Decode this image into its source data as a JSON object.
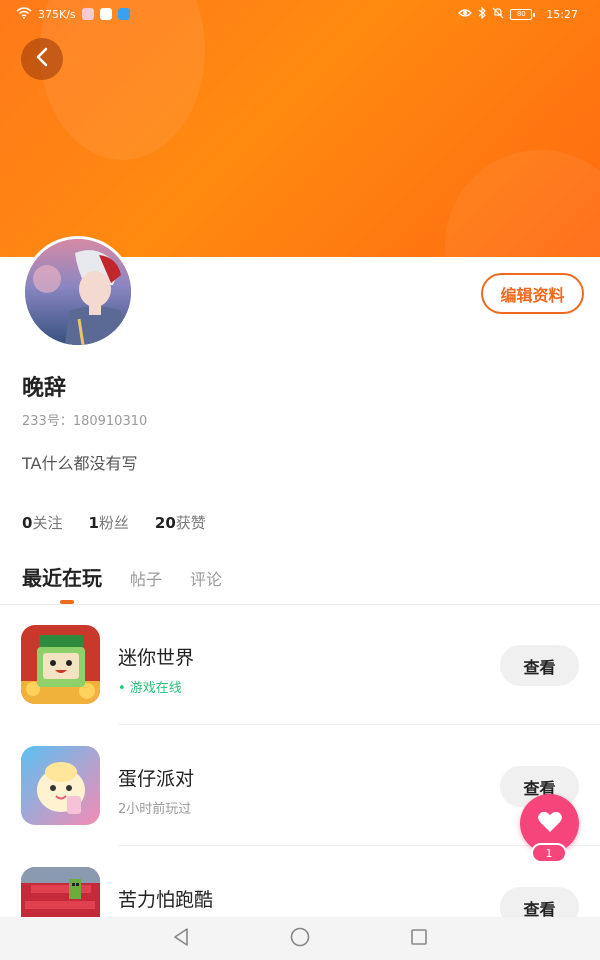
{
  "status_bar": {
    "speed": "375K/s",
    "time": "15:27",
    "battery": "80"
  },
  "profile": {
    "username": "晚辞",
    "uid_label": "233号：180910310",
    "bio": "TA什么都没有写",
    "edit_label": "编辑资料"
  },
  "stats": {
    "following": {
      "count": "0",
      "label": "关注"
    },
    "fans": {
      "count": "1",
      "label": "粉丝"
    },
    "likes": {
      "count": "20",
      "label": "获赞"
    }
  },
  "tabs": [
    "最近在玩",
    "帖子",
    "评论"
  ],
  "games": [
    {
      "name": "迷你世界",
      "status": "• 游戏在线",
      "online": true,
      "action": "查看"
    },
    {
      "name": "蛋仔派对",
      "status": "2小时前玩过",
      "online": false,
      "action": "查看"
    },
    {
      "name": "苦力怕跑酷",
      "status": "",
      "online": false,
      "action": "查看"
    }
  ],
  "fab": {
    "badge": "1",
    "icon": "heart-icon"
  },
  "colors": {
    "header": "#ff7a1a",
    "accent": "#f06a1e",
    "online": "#2ac27a",
    "fab": "#f5457a"
  }
}
